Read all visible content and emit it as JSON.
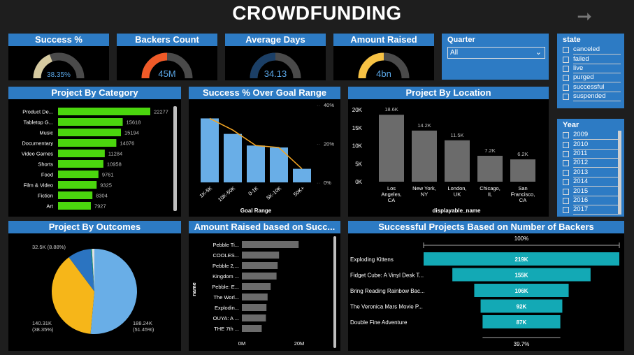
{
  "header": {
    "title": "CROWDFUNDING"
  },
  "kpis": [
    {
      "label": "Success %",
      "value": "38.35%",
      "fraction": 0.3835,
      "color": "#d6caa0"
    },
    {
      "label": "Backers Count",
      "value": "45M",
      "fraction": 0.5,
      "color": "#f05a28"
    },
    {
      "label": "Average Days",
      "value": "34.13",
      "fraction": 0.5,
      "color": "#1b3f66"
    },
    {
      "label": "Amount Raised",
      "value": "4bn",
      "fraction": 0.5,
      "color": "#f7c244"
    }
  ],
  "quarter": {
    "label": "Quarter",
    "value": "All"
  },
  "state": {
    "label": "state",
    "items": [
      "canceled",
      "failed",
      "live",
      "purged",
      "successful",
      "suspended"
    ]
  },
  "year": {
    "label": "Year",
    "items": [
      "2009",
      "2010",
      "2011",
      "2012",
      "2013",
      "2014",
      "2015",
      "2016",
      "2017"
    ]
  },
  "charts": {
    "category": {
      "title": "Project By Category",
      "chart_data": {
        "type": "bar",
        "categories": [
          "Product De...",
          "Tabletop G...",
          "Music",
          "Documentary",
          "Video Games",
          "Shorts",
          "Food",
          "Film & Video",
          "Fiction",
          "Art"
        ],
        "values": [
          22277,
          15618,
          15194,
          14076,
          11284,
          10958,
          9761,
          9325,
          8304,
          7927
        ],
        "color": "#4bd60e"
      }
    },
    "goal": {
      "title": "Success % Over Goal Range",
      "chart_data": {
        "type": "bar",
        "categories": [
          "1K-5K",
          "10K-50K",
          "0-1K",
          "5K-10K",
          "50K+"
        ],
        "values": [
          33,
          25,
          19,
          18,
          7
        ],
        "line_values": [
          33,
          27,
          19,
          18,
          7
        ],
        "xlabel": "Goal Range",
        "ylim": [
          0,
          40
        ],
        "y_ticks": [
          "40%",
          "20%",
          "0%"
        ],
        "bar_color": "#69aee7",
        "line_color": "#f5a623"
      }
    },
    "location": {
      "title": "Project By Location",
      "chart_data": {
        "type": "bar",
        "categories": [
          "Los Angeles, CA",
          "New York, NY",
          "London, UK",
          "Chicago, IL",
          "San Francisco, CA"
        ],
        "category_lines": [
          [
            "Los",
            "Angeles,",
            "CA"
          ],
          [
            "New York,",
            "NY"
          ],
          [
            "London,",
            "UK"
          ],
          [
            "Chicago,",
            "IL"
          ],
          [
            "San",
            "Francisco,",
            "CA"
          ]
        ],
        "values": [
          18600,
          14200,
          11500,
          7200,
          6200
        ],
        "data_labels": [
          "18.6K",
          "14.2K",
          "11.5K",
          "7.2K",
          "6.2K"
        ],
        "y_ticks": [
          "20K",
          "15K",
          "10K",
          "5K",
          "0K"
        ],
        "ylim": [
          0,
          20000
        ],
        "xlabel": "displayable_name",
        "color": "#6b6b6b"
      }
    },
    "outcomes": {
      "title": "Project By Outcomes",
      "chart_data": {
        "type": "pie",
        "values": [
          188240,
          140310,
          32500,
          1500,
          3400
        ],
        "colors": [
          "#69aee7",
          "#f6b619",
          "#2b74c1",
          "#1a9c85",
          "#e0e0e0"
        ],
        "labels": [
          "188.24K",
          "140.31K",
          "32.5K (8.88%)"
        ],
        "pct_labels": [
          "(51.45%)",
          "(38.35%)"
        ]
      }
    },
    "amount": {
      "title": "Amount Raised based on Succ...",
      "chart_data": {
        "type": "bar",
        "categories": [
          "Pebble Ti...",
          "COOLES...",
          "Pebble 2,...",
          "Kingdom ...",
          "Pebble: E...",
          "The Worl...",
          "Explodin...",
          "OUYA: A ...",
          "THE 7th ..."
        ],
        "values": [
          20.3,
          13.3,
          12.8,
          12.4,
          10.3,
          9.2,
          8.8,
          8.6,
          7.1
        ],
        "ylabel": "name",
        "x_ticks": [
          "0M",
          "20M"
        ],
        "color": "#6b6b6b"
      }
    },
    "funnel": {
      "title": "Successful Projects Based on Number of Backers",
      "chart_data": {
        "type": "bar",
        "categories": [
          "Exploding Kittens",
          "Fidget Cube: A Vinyl Desk T...",
          "Bring Reading Rainbow Bac...",
          "The Veronica Mars Movie P...",
          "Double Fine Adventure"
        ],
        "values": [
          219382,
          154926,
          105857,
          91585,
          87142
        ],
        "data_labels": [
          "219K",
          "155K",
          "106K",
          "92K",
          "87K"
        ],
        "top_label": "100%",
        "bottom_label": "39.7%",
        "color": "#13a9b5"
      }
    }
  }
}
